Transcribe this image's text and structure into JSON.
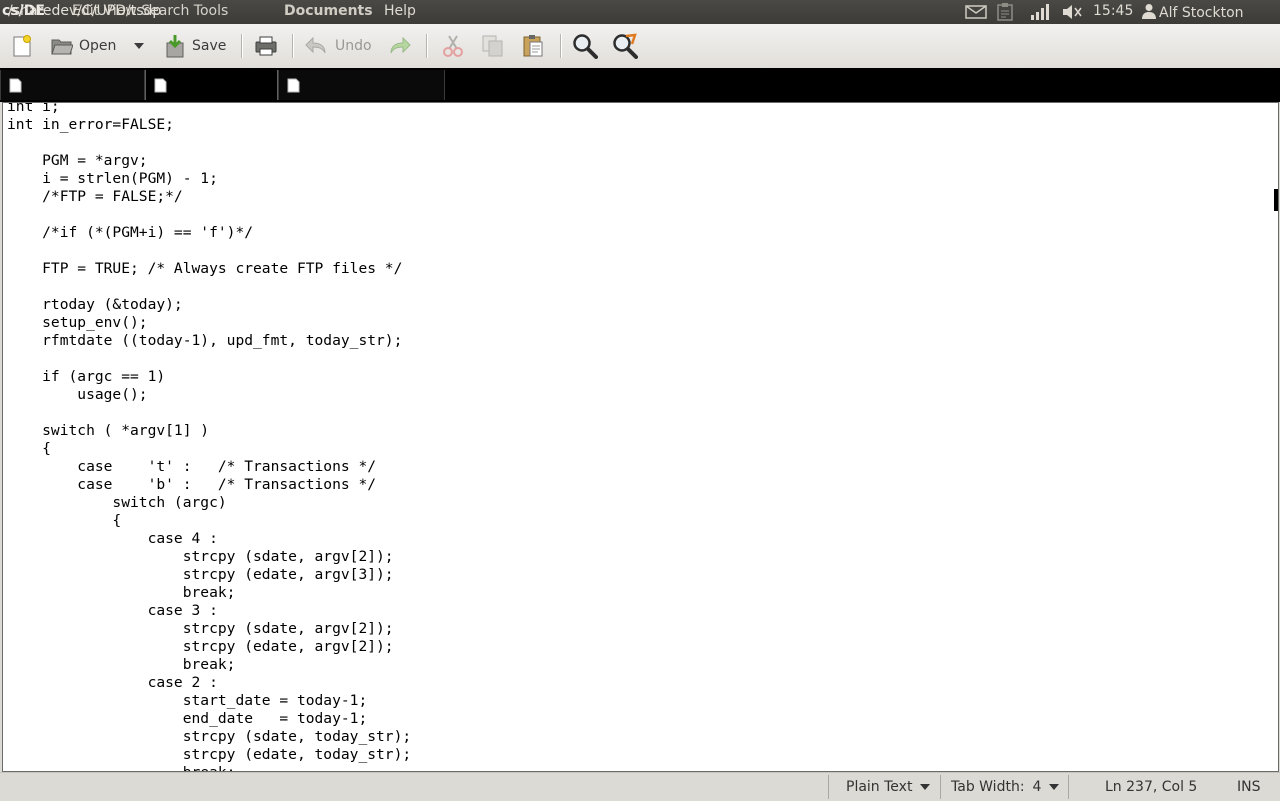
{
  "topbar": {
    "overlapping_title_texts": [
      "cs/DE",
      "Edit  View  Search  Tools",
      "/sharedev/C/UPD/tsdp",
      "Documents"
    ],
    "menu_help": "Help",
    "clock": "15:45",
    "user_name": "Alf Stockton"
  },
  "toolbar": {
    "open_label": "Open",
    "save_label": "Save",
    "undo_label": "Undo"
  },
  "tabs": [
    {
      "active": false
    },
    {
      "active": true
    },
    {
      "active": false
    }
  ],
  "editor": {
    "code": "int i;\nint in_error=FALSE;\n\n    PGM = *argv;\n    i = strlen(PGM) - 1;\n    /*FTP = FALSE;*/\n\n    /*if (*(PGM+i) == 'f')*/\n\n    FTP = TRUE; /* Always create FTP files */\n\n    rtoday (&today);\n    setup_env();\n    rfmtdate ((today-1), upd_fmt, today_str);\n\n    if (argc == 1)\n        usage();\n\n    switch ( *argv[1] )\n    {\n        case    't' :   /* Transactions */\n        case    'b' :   /* Transactions */\n            switch (argc)\n            {\n                case 4 :\n                    strcpy (sdate, argv[2]);\n                    strcpy (edate, argv[3]);\n                    break;\n                case 3 :\n                    strcpy (sdate, argv[2]);\n                    strcpy (edate, argv[2]);\n                    break;\n                case 2 :\n                    start_date = today-1;\n                    end_date   = today-1;\n                    strcpy (sdate, today_str);\n                    strcpy (edate, today_str);\n                    break;"
  },
  "statusbar": {
    "language": "Plain Text",
    "tab_width_label": "Tab Width:",
    "tab_width_value": "4",
    "position": "Ln 237, Col 5",
    "mode": "INS"
  },
  "colors": {
    "panel": "#3c3b37",
    "toolbar": "#e8e6e2",
    "tabstrip": "#000000",
    "editor_bg": "#ffffff"
  },
  "icons": [
    "new-document-icon",
    "open-icon",
    "dropdown-arrow-icon",
    "save-icon",
    "print-icon",
    "undo-icon",
    "redo-icon",
    "cut-icon",
    "copy-icon",
    "paste-icon",
    "find-icon",
    "find-replace-icon",
    "mail-icon",
    "clipboard-icon",
    "network-icon",
    "volume-icon",
    "user-icon",
    "document-icon"
  ]
}
